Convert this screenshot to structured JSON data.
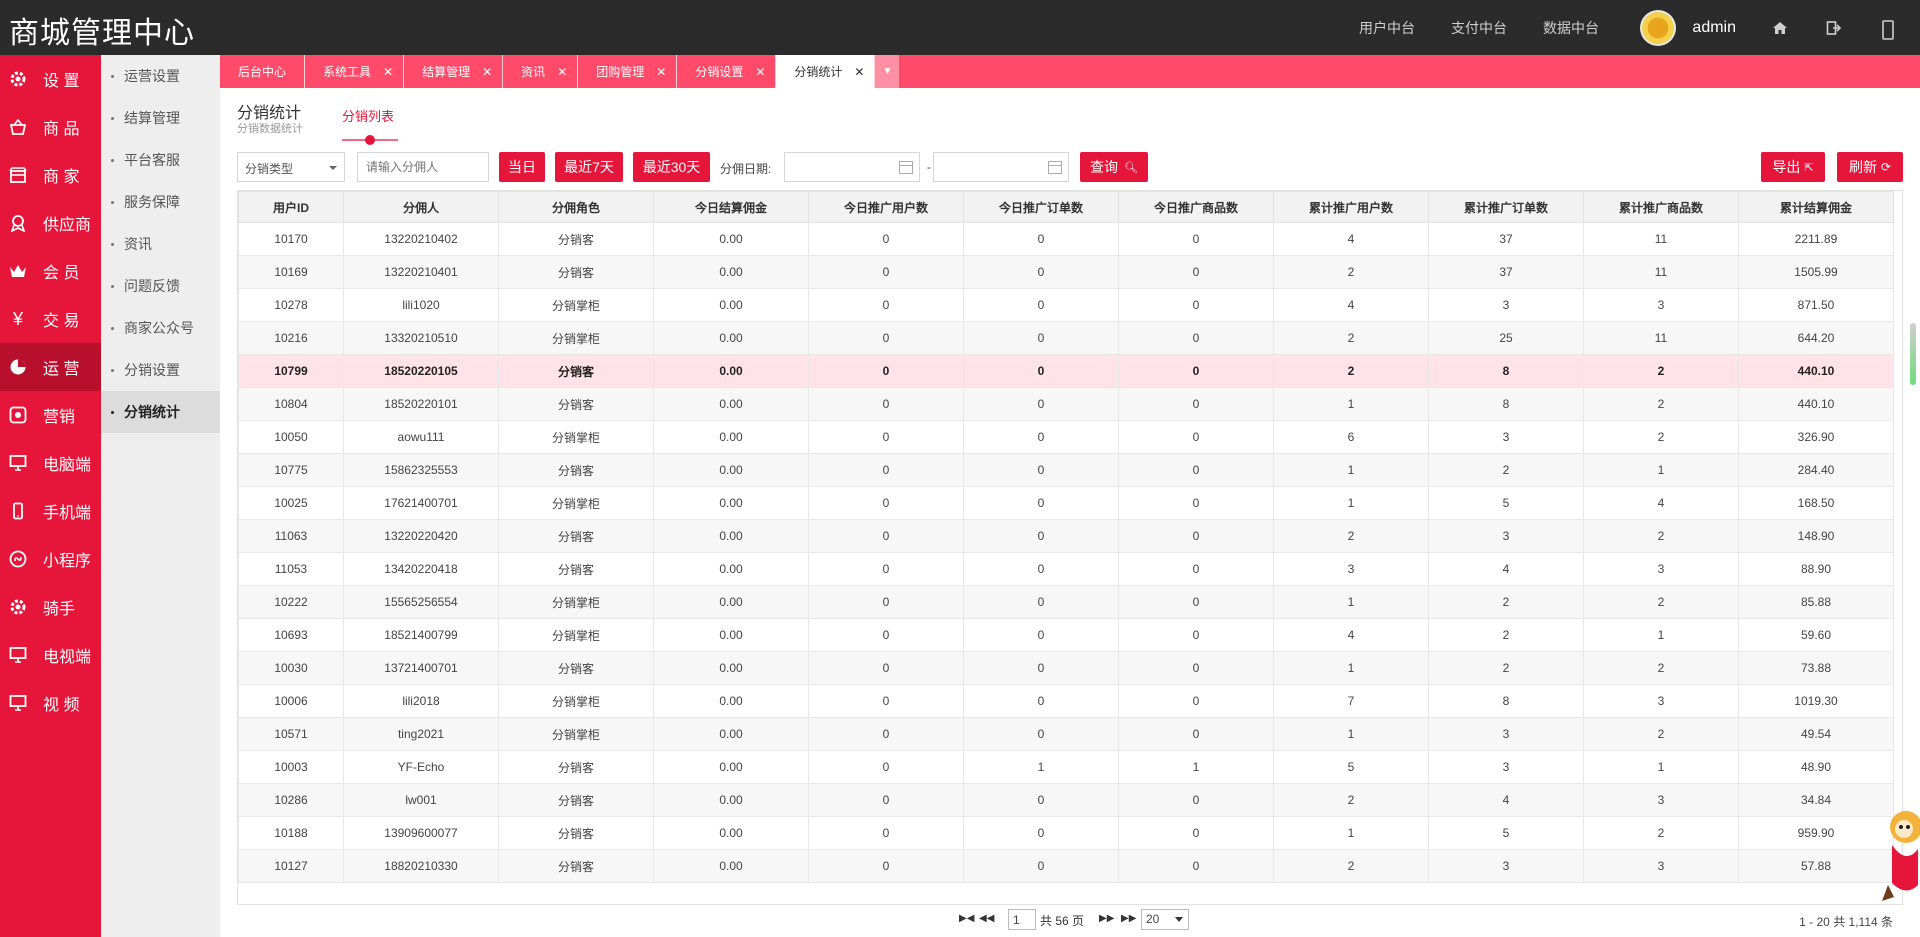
{
  "app_title": "商城管理中心",
  "top_nav": [
    "用户中台",
    "支付中台",
    "数据中台"
  ],
  "user": {
    "name": "admin"
  },
  "main_menu": [
    {
      "label": "设 置",
      "icon": "gear-icon"
    },
    {
      "label": "商 品",
      "icon": "basket-icon"
    },
    {
      "label": "商 家",
      "icon": "store-icon"
    },
    {
      "label": "供应商",
      "icon": "supplier-icon"
    },
    {
      "label": "会 员",
      "icon": "crown-icon"
    },
    {
      "label": "交 易",
      "icon": "yen-icon"
    },
    {
      "label": "运 营",
      "icon": "pie-chart-icon",
      "active": true
    },
    {
      "label": "营销",
      "icon": "marketing-icon"
    },
    {
      "label": "电脑端",
      "icon": "monitor-icon"
    },
    {
      "label": "手机端",
      "icon": "phone-icon"
    },
    {
      "label": "小程序",
      "icon": "miniapp-icon"
    },
    {
      "label": "骑手",
      "icon": "rider-icon"
    },
    {
      "label": "电视端",
      "icon": "tv-icon"
    },
    {
      "label": "视 频",
      "icon": "video-icon"
    }
  ],
  "sub_menu": [
    {
      "label": "运营设置"
    },
    {
      "label": "结算管理"
    },
    {
      "label": "平台客服"
    },
    {
      "label": "服务保障"
    },
    {
      "label": "资讯"
    },
    {
      "label": "问题反馈"
    },
    {
      "label": "商家公众号"
    },
    {
      "label": "分销设置"
    },
    {
      "label": "分销统计",
      "active": true
    }
  ],
  "tabs": [
    {
      "label": "后台中心",
      "closable": false
    },
    {
      "label": "系统工具",
      "closable": true
    },
    {
      "label": "结算管理",
      "closable": true
    },
    {
      "label": "资讯",
      "closable": true
    },
    {
      "label": "团购管理",
      "closable": true
    },
    {
      "label": "分销设置",
      "closable": true
    },
    {
      "label": "分销统计",
      "closable": true,
      "active": true
    }
  ],
  "page": {
    "title": "分销统计",
    "subtitle": "分销数据统计",
    "subtab": "分销列表"
  },
  "filters": {
    "type_select": "分销类型",
    "name_placeholder": "请输入分佣人",
    "btn_today": "当日",
    "btn_7days": "最近7天",
    "btn_30days": "最近30天",
    "date_label": "分佣日期:",
    "date_sep": "-",
    "btn_search": "查询",
    "btn_export": "导出",
    "btn_refresh": "刷新"
  },
  "table": {
    "columns": [
      "用户ID",
      "分佣人",
      "分佣角色",
      "今日结算佣金",
      "今日推广用户数",
      "今日推广订单数",
      "今日推广商品数",
      "累计推广用户数",
      "累计推广订单数",
      "累计推广商品数",
      "累计结算佣金"
    ],
    "rows": [
      [
        "10170",
        "13220210402",
        "分销客",
        "0.00",
        "0",
        "0",
        "0",
        "4",
        "37",
        "11",
        "2211.89"
      ],
      [
        "10169",
        "13220210401",
        "分销客",
        "0.00",
        "0",
        "0",
        "0",
        "2",
        "37",
        "11",
        "1505.99"
      ],
      [
        "10278",
        "lili1020",
        "分销掌柜",
        "0.00",
        "0",
        "0",
        "0",
        "4",
        "3",
        "3",
        "871.50"
      ],
      [
        "10216",
        "13320210510",
        "分销掌柜",
        "0.00",
        "0",
        "0",
        "0",
        "2",
        "25",
        "11",
        "644.20"
      ],
      [
        "10799",
        "18520220105",
        "分销客",
        "0.00",
        "0",
        "0",
        "0",
        "2",
        "8",
        "2",
        "440.10"
      ],
      [
        "10804",
        "18520220101",
        "分销客",
        "0.00",
        "0",
        "0",
        "0",
        "1",
        "8",
        "2",
        "440.10"
      ],
      [
        "10050",
        "aowu111",
        "分销掌柜",
        "0.00",
        "0",
        "0",
        "0",
        "6",
        "3",
        "2",
        "326.90"
      ],
      [
        "10775",
        "15862325553",
        "分销客",
        "0.00",
        "0",
        "0",
        "0",
        "1",
        "2",
        "1",
        "284.40"
      ],
      [
        "10025",
        "17621400701",
        "分销掌柜",
        "0.00",
        "0",
        "0",
        "0",
        "1",
        "5",
        "4",
        "168.50"
      ],
      [
        "11063",
        "13220220420",
        "分销客",
        "0.00",
        "0",
        "0",
        "0",
        "2",
        "3",
        "2",
        "148.90"
      ],
      [
        "11053",
        "13420220418",
        "分销客",
        "0.00",
        "0",
        "0",
        "0",
        "3",
        "4",
        "3",
        "88.90"
      ],
      [
        "10222",
        "15565256554",
        "分销掌柜",
        "0.00",
        "0",
        "0",
        "0",
        "1",
        "2",
        "2",
        "85.88"
      ],
      [
        "10693",
        "18521400799",
        "分销掌柜",
        "0.00",
        "0",
        "0",
        "0",
        "4",
        "2",
        "1",
        "59.60"
      ],
      [
        "10030",
        "13721400701",
        "分销客",
        "0.00",
        "0",
        "0",
        "0",
        "1",
        "2",
        "2",
        "73.88"
      ],
      [
        "10006",
        "lili2018",
        "分销掌柜",
        "0.00",
        "0",
        "0",
        "0",
        "7",
        "8",
        "3",
        "1019.30"
      ],
      [
        "10571",
        "ting2021",
        "分销掌柜",
        "0.00",
        "0",
        "0",
        "0",
        "1",
        "3",
        "2",
        "49.54"
      ],
      [
        "10003",
        "YF-Echo",
        "分销客",
        "0.00",
        "0",
        "1",
        "1",
        "5",
        "3",
        "1",
        "48.90"
      ],
      [
        "10286",
        "lw001",
        "分销客",
        "0.00",
        "0",
        "0",
        "0",
        "2",
        "4",
        "3",
        "34.84"
      ],
      [
        "10188",
        "13909600077",
        "分销客",
        "0.00",
        "0",
        "0",
        "0",
        "1",
        "5",
        "2",
        "959.90"
      ],
      [
        "10127",
        "18820210330",
        "分销客",
        "0.00",
        "0",
        "0",
        "0",
        "2",
        "3",
        "3",
        "57.88"
      ]
    ],
    "highlighted_row": 4
  },
  "pager": {
    "first": "▶◀",
    "current_page": "1",
    "total_pages_text": "共 56 页",
    "page_size": "20",
    "summary": "1 - 20  共 1,114 条"
  },
  "colors": {
    "brand_red": "#e5163a",
    "tab_pink": "#ff4a6a",
    "topbar": "#2b2b2b"
  }
}
